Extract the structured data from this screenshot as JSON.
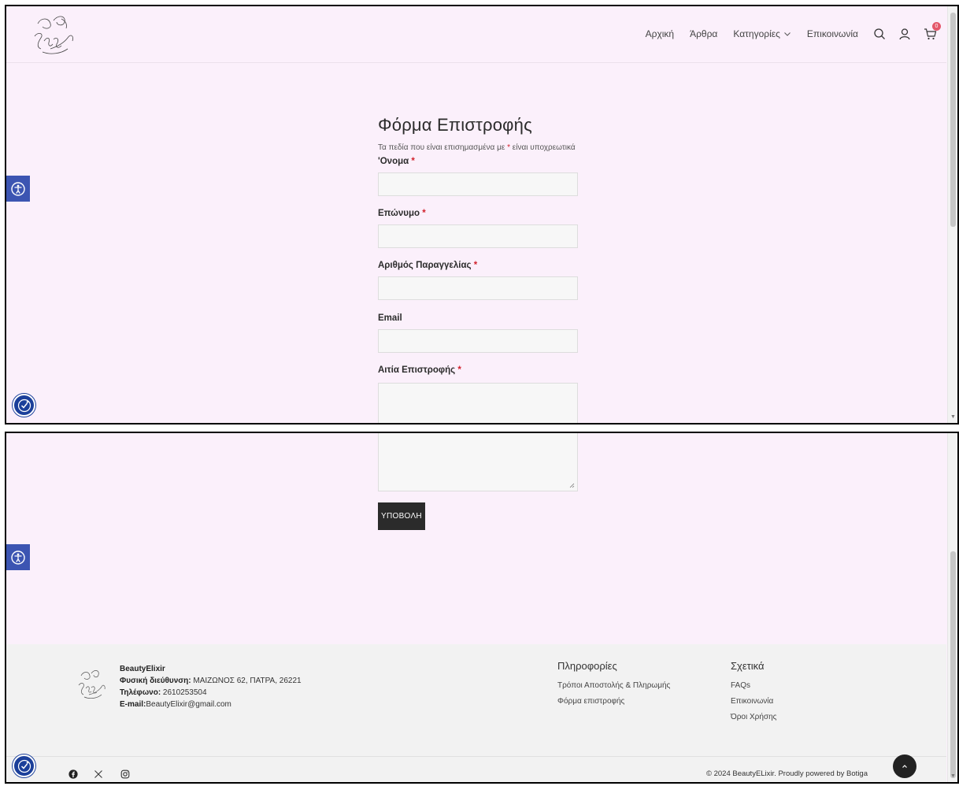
{
  "header": {
    "nav": [
      {
        "label": "Αρχική"
      },
      {
        "label": "Άρθρα"
      },
      {
        "label": "Κατηγορίες"
      },
      {
        "label": "Επικοινωνία"
      }
    ],
    "cart_count": "0",
    "icons": [
      "search-icon",
      "user-icon",
      "cart-icon"
    ]
  },
  "form": {
    "title": "Φόρμα Επιστροφής",
    "note_before": "Τα πεδία που είναι επισημασμένα με ",
    "note_star": "*",
    "note_after": " είναι υποχρεωτικά",
    "required_mark": "*",
    "fields": [
      {
        "label": "'Ονομα",
        "required": true,
        "value": ""
      },
      {
        "label": "Επώνυμο",
        "required": true,
        "value": ""
      },
      {
        "label": "Αριθμός Παραγγελίας",
        "required": true,
        "value": ""
      },
      {
        "label": "Email",
        "required": false,
        "value": ""
      },
      {
        "label": "Αιτία Επιστροφής",
        "required": true,
        "value": ""
      }
    ],
    "submit_label": "ΥΠΟΒΟΛΗ"
  },
  "footer": {
    "brand": "BeautyElixir",
    "address_label": "Φυσική διεύθυνση:",
    "address_value": " ΜΑΙΖΩΝΟΣ 62, ΠΑΤΡΑ, 26221",
    "phone_label": "Τηλέφωνο:",
    "phone_value": " 2610253504",
    "email_label": "E-mail:",
    "email_value": "BeautyElixir@gmail.com",
    "col1": {
      "heading": "Πληροφορίες",
      "links": [
        "Τρόποι Αποστολής & Πληρωμής",
        "Φόρμα επιστροφής"
      ]
    },
    "col2": {
      "heading": "Σχετικά",
      "links": [
        "FAQs",
        "Επικοινωνία",
        "Όροι Χρήσης"
      ]
    },
    "copyright": "© 2024 BeautyELixir. Proudly powered by Botiga",
    "social": [
      "facebook-icon",
      "x-icon",
      "instagram-icon"
    ]
  },
  "colors": {
    "page_bg": "#fbf0fb",
    "footer_bg": "#f2f2f2",
    "required": "#d2222d",
    "button": "#2b2b2b",
    "accessibility": "#3c55b2"
  }
}
